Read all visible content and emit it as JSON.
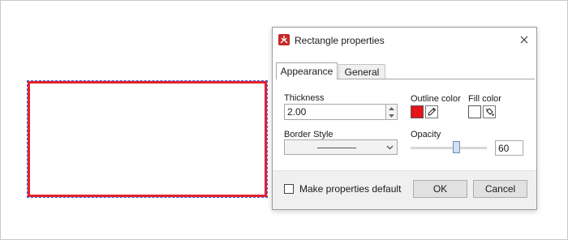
{
  "dialog": {
    "title": "Rectangle properties",
    "icon": "pdf-app-icon"
  },
  "tabs": [
    {
      "label": "Appearance",
      "active": true
    },
    {
      "label": "General",
      "active": false
    }
  ],
  "appearance": {
    "thickness_label": "Thickness",
    "thickness_value": "2.00",
    "outline_color_label": "Outline color",
    "outline_color": "#e8121a",
    "fill_color_label": "Fill color",
    "fill_color": "#ffffff",
    "border_style_label": "Border Style",
    "border_style_value": "solid",
    "opacity_label": "Opacity",
    "opacity_value": "60"
  },
  "footer": {
    "make_default_label": "Make properties default",
    "make_default_checked": false,
    "ok_label": "OK",
    "cancel_label": "Cancel"
  },
  "canvas": {
    "rectangle_color": "#e3222d"
  }
}
